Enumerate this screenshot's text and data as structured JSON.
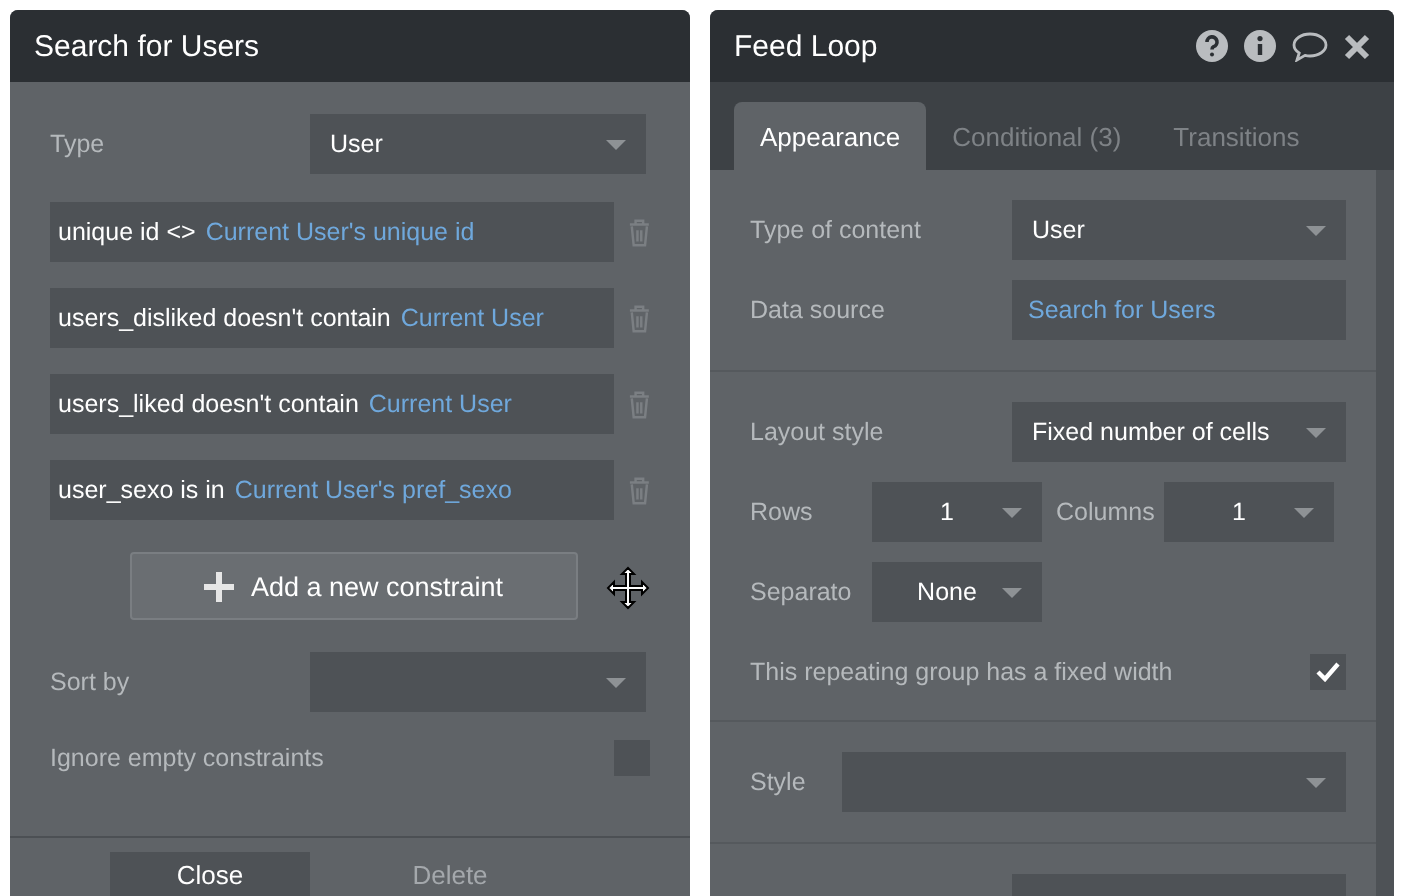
{
  "search_panel": {
    "title": "Search for Users",
    "type": {
      "label": "Type",
      "value": "User"
    },
    "constraints": [
      {
        "field": "unique id <>",
        "value": "Current User's unique id"
      },
      {
        "field": "users_disliked doesn't contain",
        "value": "Current User"
      },
      {
        "field": "users_liked doesn't contain",
        "value": "Current User"
      },
      {
        "field": "user_sexo is in",
        "value": "Current User's pref_sexo"
      }
    ],
    "add_button": "Add a new constraint",
    "sort_by": {
      "label": "Sort by"
    },
    "ignore_empty": {
      "label": "Ignore empty constraints",
      "checked": false
    },
    "buttons": [
      {
        "label": "Close",
        "disabled": false
      },
      {
        "label": "Delete",
        "disabled": true
      }
    ]
  },
  "feed_panel": {
    "title": "Feed Loop",
    "tabs": [
      {
        "label": "Appearance",
        "selected": true
      },
      {
        "label": "Conditional (3)",
        "selected": false
      },
      {
        "label": "Transitions",
        "selected": false
      }
    ],
    "type_of_content": {
      "label": "Type of content",
      "value": "User"
    },
    "data_source": {
      "label": "Data source",
      "value": "Search for Users"
    },
    "layout_style": {
      "label": "Layout style",
      "value": "Fixed number of cells"
    },
    "rows": {
      "label": "Rows",
      "value": "1"
    },
    "columns": {
      "label": "Columns",
      "value": "1"
    },
    "separator": {
      "label": "Separato",
      "value": "None"
    },
    "fixed_width": {
      "label": "This repeating group has a fixed width",
      "checked": true
    },
    "style": {
      "label": "Style"
    }
  }
}
